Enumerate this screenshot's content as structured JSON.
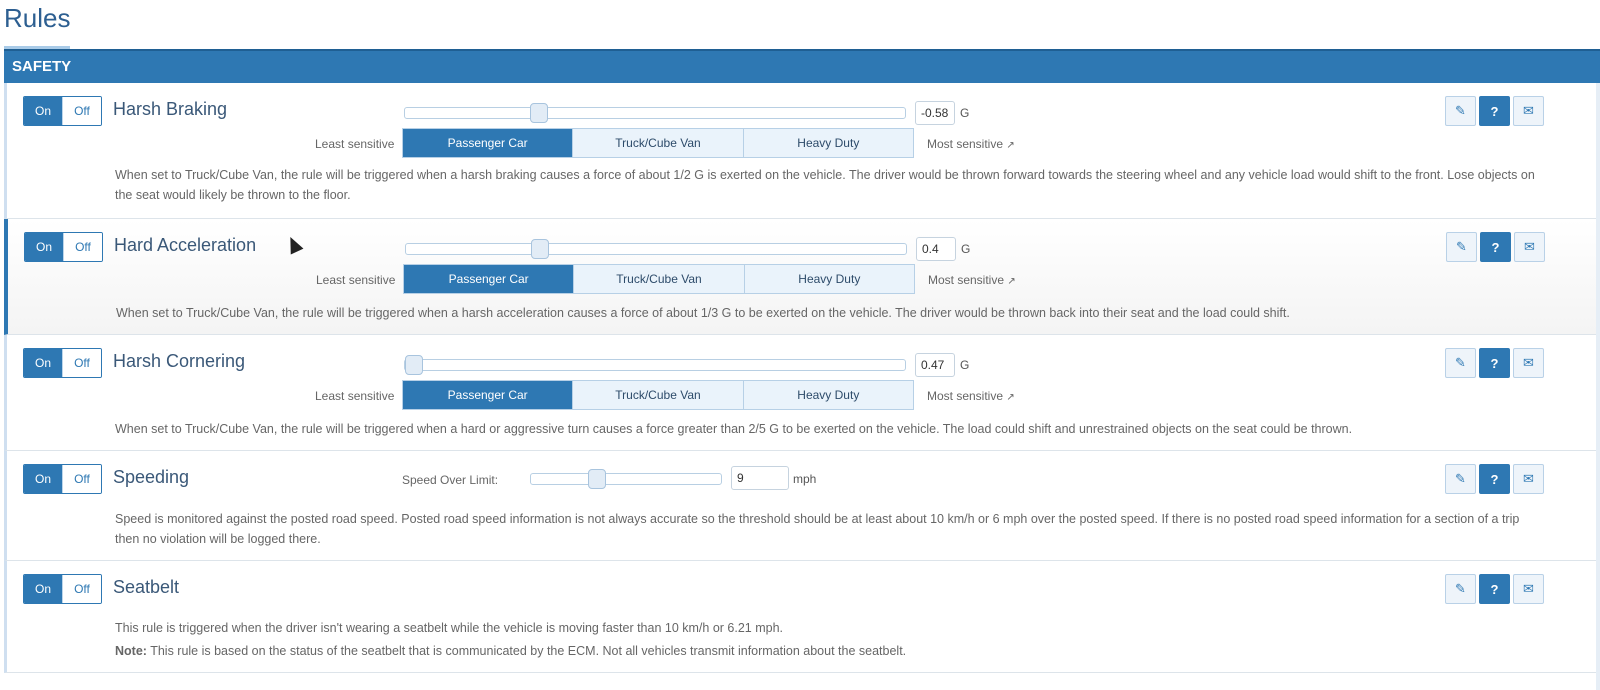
{
  "page": {
    "title": "Rules"
  },
  "section": {
    "title": "SAFETY"
  },
  "common": {
    "on": "On",
    "off": "Off",
    "least": "Least sensitive",
    "most": "Most sensitive",
    "presets": [
      "Passenger Car",
      "Truck/Cube Van",
      "Heavy Duty"
    ],
    "selected_preset": "Passenger Car",
    "icons": {
      "edit": "pencil-icon",
      "help": "question-icon",
      "notify": "envelope-icon",
      "external": "external-link-icon"
    }
  },
  "rules": [
    {
      "name": "Harsh Braking",
      "value": "-0.58",
      "unit": "G",
      "slider_fraction": 0.26,
      "desc": "When set to Truck/Cube Van, the rule will be triggered when a harsh braking causes a force of about 1/2 G is exerted on the vehicle. The driver would be thrown forward towards the steering wheel and any vehicle load would shift to the front. Lose objects on the seat would likely be thrown to the floor."
    },
    {
      "name": "Hard Acceleration",
      "value": "0.4",
      "unit": "G",
      "slider_fraction": 0.26,
      "desc": "When set to Truck/Cube Van, the rule will be triggered when a harsh acceleration causes a force of about 1/3 G to be exerted on the vehicle. The driver would be thrown back into their seat and the load could shift."
    },
    {
      "name": "Harsh Cornering",
      "value": "0.47",
      "unit": "G",
      "slider_fraction": 0.0,
      "desc": "When set to Truck/Cube Van, the rule will be triggered when a hard or aggressive turn causes a force greater than 2/5 G to be exerted on the vehicle. The load could shift and unrestrained objects on the seat could be thrown."
    },
    {
      "name": "Speeding",
      "label": "Speed Over Limit:",
      "value": "9",
      "unit": "mph",
      "slider_fraction": 0.33,
      "desc": "Speed is monitored against the posted road speed. Posted road speed information is not always accurate so the threshold should be at least about 10 km/h or 6 mph over the posted speed. If there is no posted road speed information for a section of a trip then no violation will be logged there."
    },
    {
      "name": "Seatbelt",
      "desc": "This rule is triggered when the driver isn't wearing a seatbelt while the vehicle is moving faster than 10 km/h or 6.21 mph.",
      "note_label": "Note:",
      "note": " This rule is based on the status of the seatbelt that is communicated by the ECM. Not all vehicles transmit information about the seatbelt."
    }
  ]
}
